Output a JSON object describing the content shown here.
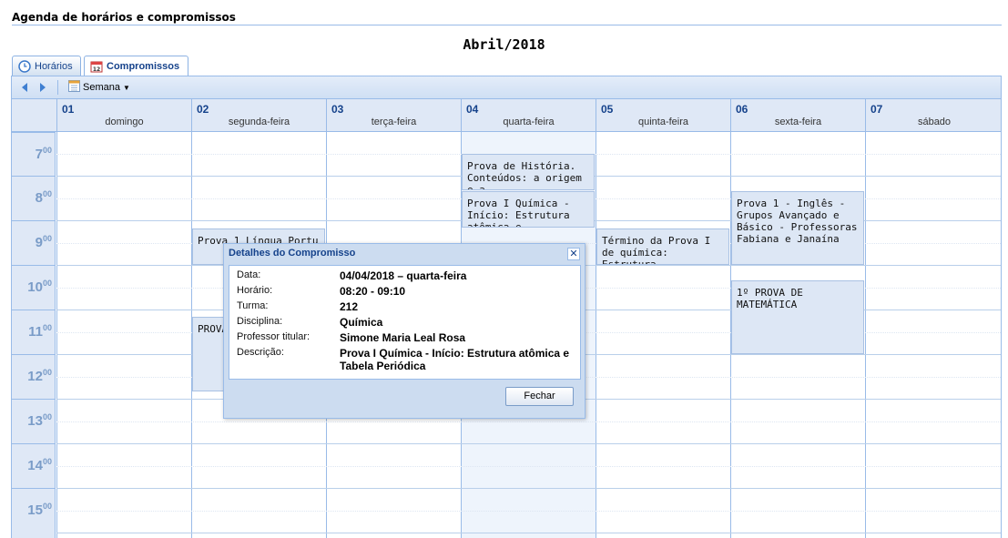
{
  "page_title": "Agenda de horários e compromissos",
  "month_title": "Abril/2018",
  "tabs": [
    {
      "label": "Horários",
      "icon": "clock-icon",
      "active": false
    },
    {
      "label": "Compromissos",
      "icon": "calendar-icon",
      "active": true
    }
  ],
  "toolbar": {
    "prev_icon": "arrow-left-icon",
    "next_icon": "arrow-right-icon",
    "view_label": "Semana"
  },
  "days": [
    {
      "num": "01",
      "name": "domingo"
    },
    {
      "num": "02",
      "name": "segunda-feira"
    },
    {
      "num": "03",
      "name": "terça-feira"
    },
    {
      "num": "04",
      "name": "quarta-feira"
    },
    {
      "num": "05",
      "name": "quinta-feira"
    },
    {
      "num": "06",
      "name": "sexta-feira"
    },
    {
      "num": "07",
      "name": "sábado"
    }
  ],
  "hours": [
    {
      "h": "7",
      "m": "00"
    },
    {
      "h": "8",
      "m": "00"
    },
    {
      "h": "9",
      "m": "00"
    },
    {
      "h": "10",
      "m": "00"
    },
    {
      "h": "11",
      "m": "00"
    },
    {
      "h": "12",
      "m": "00"
    },
    {
      "h": "13",
      "m": "00"
    },
    {
      "h": "14",
      "m": "00"
    },
    {
      "h": "15",
      "m": "00"
    }
  ],
  "events": [
    {
      "text": "Prova de História. Conteúdos: a origem e a"
    },
    {
      "text": "Prova I Química - Início: Estrutura atômica e"
    },
    {
      "text": "Prova 1 Língua Portu"
    },
    {
      "text": "PROVA"
    },
    {
      "text": "Término da Prova I de química: Estrutura"
    },
    {
      "text": "Prova 1 - Inglês - Grupos Avançado e Básico - Professoras Fabiana e Janaína"
    },
    {
      "text": "1º PROVA DE MATEMÁTICA"
    }
  ],
  "dialog": {
    "title": "Detalhes do Compromisso",
    "close_icon": "close-icon",
    "rows": [
      {
        "label": "Data:",
        "value": "04/04/2018 – quarta-feira"
      },
      {
        "label": "Horário:",
        "value": "08:20 - 09:10"
      },
      {
        "label": "Turma:",
        "value": "212"
      },
      {
        "label": "Disciplina:",
        "value": "Química"
      },
      {
        "label": "Professor titular:",
        "value": "Simone Maria Leal Rosa"
      },
      {
        "label": "Descrição:",
        "value": "Prova I Química - Início: Estrutura atômica e Tabela Periódica"
      }
    ],
    "button_label": "Fechar"
  },
  "colors": {
    "accent": "#15428b",
    "border": "#99bbe8",
    "header_bg": "#dfe8f6",
    "event_bg": "#dde7f5",
    "today_bg": "#eef4fc"
  }
}
